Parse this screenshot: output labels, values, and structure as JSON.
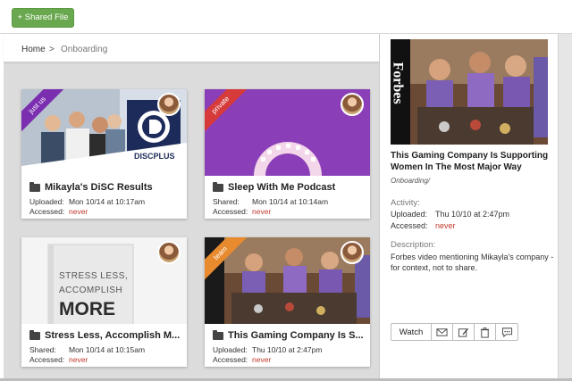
{
  "toolbar": {
    "shared_file_label": "+ Shared File"
  },
  "breadcrumb": {
    "home": "Home",
    "separator": ">",
    "current": "Onboarding"
  },
  "cards": [
    {
      "ribbon": "just us",
      "ribbon_color": "#7b2fb0",
      "title": "Mikayla's DiSC Results",
      "row1_label": "Uploaded:",
      "row1_value": "Mon 10/14 at 10:17am",
      "row2_label": "Accessed:",
      "row2_value": "never",
      "thumb_text": "DISCPLUS"
    },
    {
      "ribbon": "private",
      "ribbon_color": "#d63a3a",
      "title": "Sleep With Me Podcast",
      "row1_label": "Shared:",
      "row1_value": "Mon 10/14 at 10:14am",
      "row2_label": "Accessed:",
      "row2_value": "never"
    },
    {
      "ribbon": "",
      "title": "Stress Less, Accomplish M...",
      "row1_label": "Shared:",
      "row1_value": "Mon 10/14 at 10:15am",
      "row2_label": "Accessed:",
      "row2_value": "never",
      "thumb_lines": [
        "STRESS LESS,",
        "ACCOMPLISH",
        "MORE"
      ]
    },
    {
      "ribbon": "team",
      "ribbon_color": "#e88a2e",
      "title": "This Gaming Company Is S...",
      "row1_label": "Uploaded:",
      "row1_value": "Thu 10/10 at 2:47pm",
      "row2_label": "Accessed:",
      "row2_value": "never"
    }
  ],
  "detail": {
    "title": "This Gaming Company Is Supporting Women In The Most Major Way",
    "folder": "Onboarding/",
    "activity_label": "Activity:",
    "uploaded_label": "Uploaded:",
    "uploaded_value": "Thu 10/10 at 2:47pm",
    "accessed_label": "Accessed:",
    "accessed_value": "never",
    "description_label": "Description:",
    "description": "Forbes video mentioning Mikayla's company - for context, not to share.",
    "watch_label": "Watch",
    "image_brand": "Forbes"
  },
  "colors": {
    "accent_green": "#6aa84f",
    "never_red": "#c0392b",
    "podcast_purple": "#8a3fb8"
  }
}
